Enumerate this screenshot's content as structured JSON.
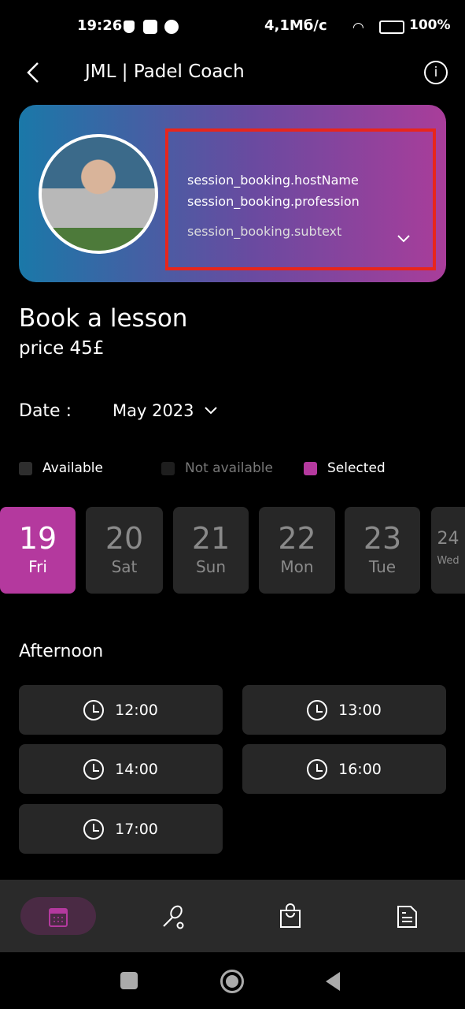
{
  "status_bar": {
    "time": "19:26",
    "network_speed": "4,1Мб/с",
    "battery": "100%"
  },
  "header": {
    "title": "JML | Padel Coach"
  },
  "host_card": {
    "host_name": "session_booking.hostName",
    "profession": "session_booking.profession",
    "subtext": "session_booking.subtext"
  },
  "booking": {
    "title": "Book a lesson",
    "price": "price 45£",
    "date_label": "Date :",
    "date_value": "May 2023"
  },
  "legend": [
    {
      "label": "Available",
      "color": "#2e2e2e"
    },
    {
      "label": "Not available",
      "color": "#1e1e1e"
    },
    {
      "label": "Selected",
      "color": "#b4399e"
    }
  ],
  "days": [
    {
      "num": "19",
      "wd": "Fri",
      "selected": true
    },
    {
      "num": "20",
      "wd": "Sat"
    },
    {
      "num": "21",
      "wd": "Sun"
    },
    {
      "num": "22",
      "wd": "Mon"
    },
    {
      "num": "23",
      "wd": "Tue"
    },
    {
      "num": "24",
      "wd": "Wed"
    }
  ],
  "section": "Afternoon",
  "slots": [
    "12:00",
    "13:00",
    "14:00",
    "16:00",
    "17:00"
  ],
  "bottom_nav": [
    "calendar-icon",
    "racket-icon",
    "shopping-bag-icon",
    "document-icon"
  ],
  "accent": "#b4399e"
}
